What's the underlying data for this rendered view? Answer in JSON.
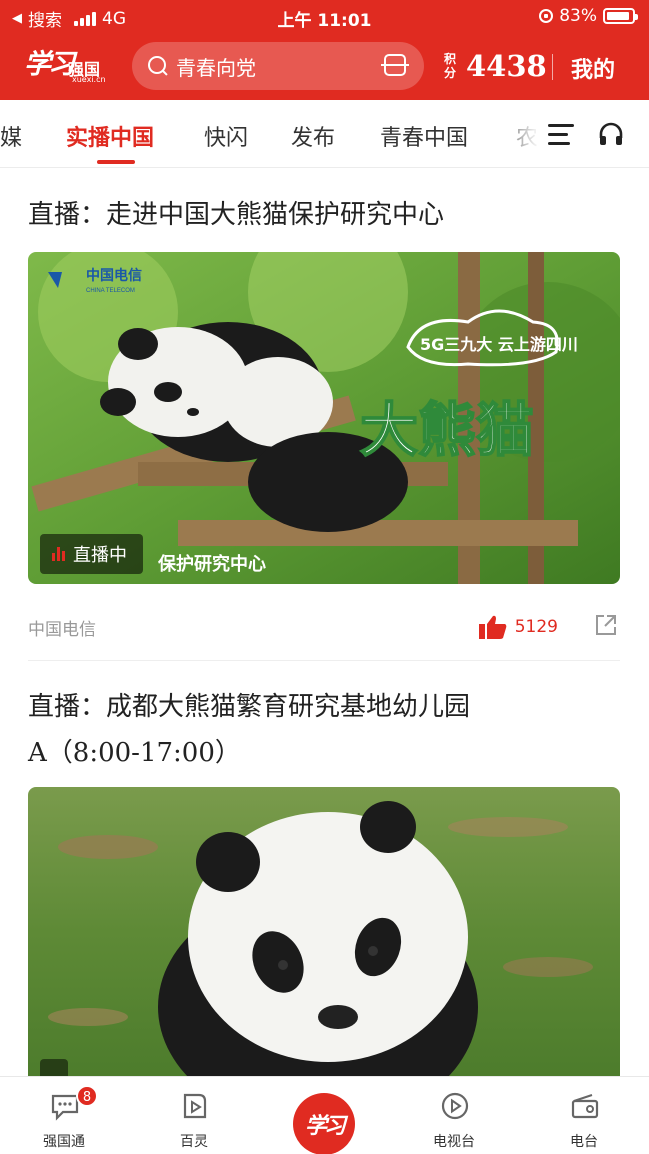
{
  "status_bar": {
    "back_label": "搜索",
    "network": "4G",
    "time": "上午 11:01",
    "battery": "83%"
  },
  "header": {
    "logo_main": "学习",
    "logo_sub": "强国",
    "logo_url": "xuexi.cn",
    "search_placeholder": "青春向党",
    "points_label": "积分",
    "points_value": "4438",
    "mine_label": "我的"
  },
  "tabs": [
    {
      "label": "媒",
      "active": false
    },
    {
      "label": "实播中国",
      "active": true
    },
    {
      "label": "快闪",
      "active": false
    },
    {
      "label": "发布",
      "active": false
    },
    {
      "label": "青春中国",
      "active": false
    },
    {
      "label": "农",
      "active": false
    }
  ],
  "feed": [
    {
      "title": "直播：走进中国大熊猫保护研究中心",
      "thumb_logo": "中国电信",
      "thumb_logo_sub": "CHINA TELECOM",
      "thumb_caption": "5G三九大 云上游四川",
      "thumb_headline": "大熊猫",
      "thumb_bottom": "保护研究中心",
      "live_label": "直播中",
      "source": "中国电信",
      "likes": "5129"
    },
    {
      "title_line1": "直播：成都大熊猫繁育研究基地幼儿园",
      "title_line2": "A（8:00-17:00）"
    }
  ],
  "bottom_nav": [
    {
      "label": "强国通",
      "icon": "chat-icon",
      "badge": "8"
    },
    {
      "label": "百灵",
      "icon": "video-icon"
    },
    {
      "label": "学习",
      "icon": "xuexi-logo"
    },
    {
      "label": "电视台",
      "icon": "play-circle-icon"
    },
    {
      "label": "电台",
      "icon": "radio-icon"
    }
  ],
  "colors": {
    "brand_red": "#e02b21",
    "text_dark": "#222222",
    "text_muted": "#999999"
  }
}
